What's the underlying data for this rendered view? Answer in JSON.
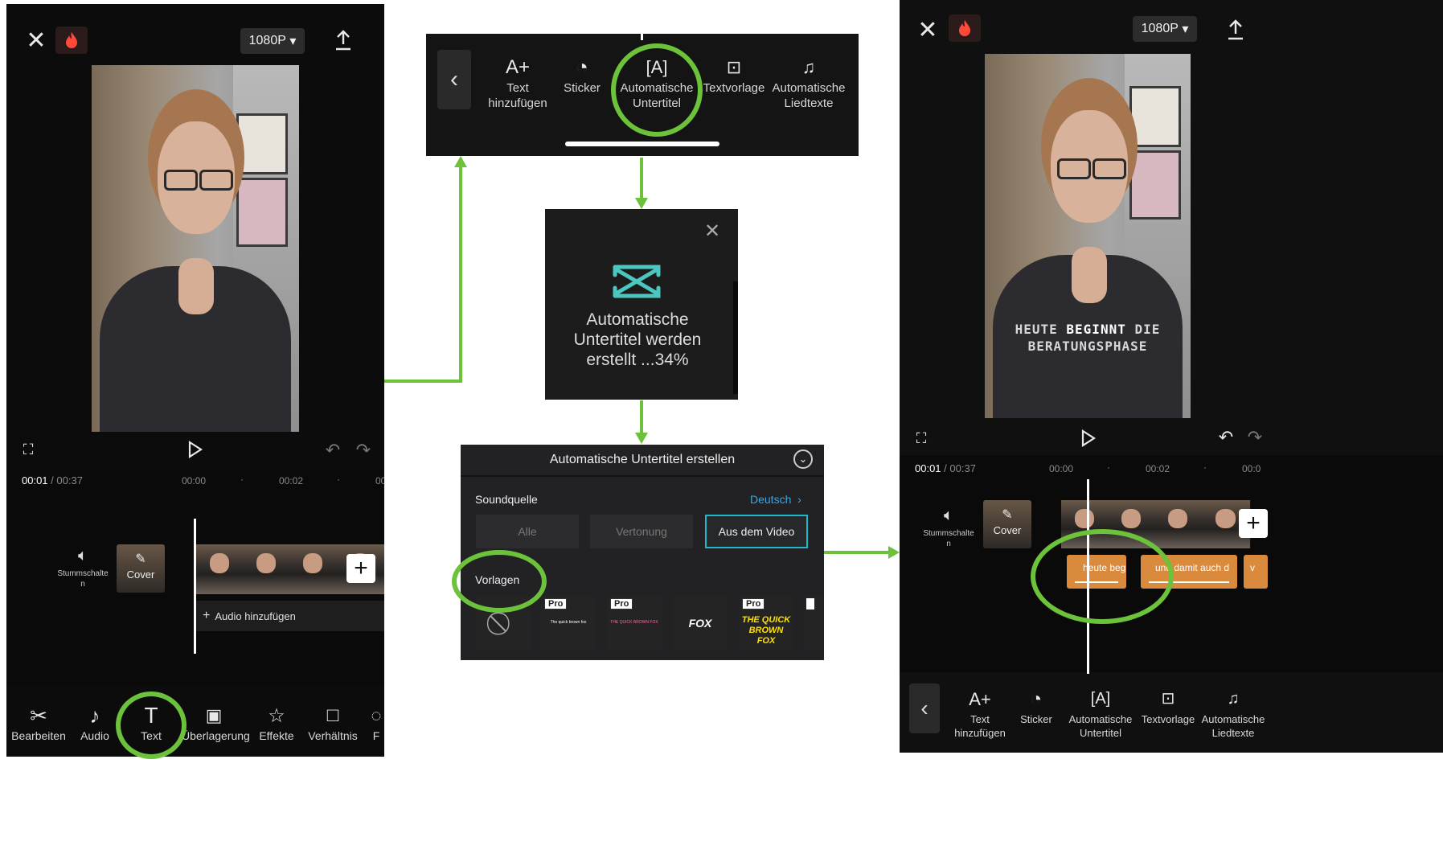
{
  "left_phone": {
    "resolution": "1080P",
    "time_current": "00:01",
    "time_sep": "/",
    "time_total": "00:37",
    "ruler": [
      "00:00",
      "00:02",
      "00"
    ],
    "mute_label": "Stummschalte\nn",
    "cover_label": "Cover",
    "add_audio": "Audio hinzufügen",
    "toolbar": [
      "Bearbeiten",
      "Audio",
      "Text",
      "Überlagerung",
      "Effekte",
      "Verhältnis",
      "F"
    ]
  },
  "text_menu": {
    "items": [
      {
        "label": "Text\nhinzufügen",
        "icon": "text-add-icon"
      },
      {
        "label": "Sticker",
        "icon": "sticker-icon"
      },
      {
        "label": "Automatische\nUntertitel",
        "icon": "auto-caption-icon"
      },
      {
        "label": "Textvorlage",
        "icon": "text-template-icon"
      },
      {
        "label": "Automatische\nLiedtexte",
        "icon": "auto-lyrics-icon"
      }
    ]
  },
  "progress_dialog": {
    "message": "Automatische\nUntertitel werden\nerstellt ...34%",
    "progress_percent": 34
  },
  "subtitle_panel": {
    "title": "Automatische Untertitel erstellen",
    "sound_source_label": "Soundquelle",
    "language": "Deutsch",
    "options": [
      "Alle",
      "Vertonung",
      "Aus dem Video"
    ],
    "selected_option": "Aus dem Video",
    "templates_label": "Vorlagen",
    "pro_badge": "Pro",
    "templates": [
      {
        "text": "",
        "pro": false
      },
      {
        "text": "The quick brown fox",
        "pro": true
      },
      {
        "text": "THE QUICK BROWN FOX",
        "pro": true
      },
      {
        "text": "FOX",
        "pro": false
      },
      {
        "text": "THE QUICK\nBROWN FOX",
        "pro": true
      }
    ]
  },
  "right_phone": {
    "resolution": "1080P",
    "time_current": "00:01",
    "time_sep": "/",
    "time_total": "00:37",
    "ruler": [
      "00:00",
      "00:02",
      "00:0"
    ],
    "caption_line1_a": "HEUTE",
    "caption_line1_b": "BEGINNT",
    "caption_line1_c": "DIE",
    "caption_line2": "BERATUNGSPHASE",
    "mute_label": "Stummschalte\nn",
    "cover_label": "Cover",
    "clips": [
      "heute beg",
      "und damit auch d",
      "v"
    ],
    "toolbar": [
      {
        "label": "Text\nhinzufügen",
        "icon": "text-add-icon"
      },
      {
        "label": "Sticker",
        "icon": "sticker-icon"
      },
      {
        "label": "Automatische\nUntertitel",
        "icon": "auto-caption-icon"
      },
      {
        "label": "Textvorlage",
        "icon": "text-template-icon"
      },
      {
        "label": "Automatische\nLiedtexte",
        "icon": "auto-lyrics-icon"
      }
    ]
  },
  "colors": {
    "highlight_green": "#6cc23a",
    "caption_clip": "#d98a3c",
    "selected_border": "#20b8c8",
    "link_blue": "#3aa8e8",
    "brand_teal": "#4cc7c0"
  }
}
